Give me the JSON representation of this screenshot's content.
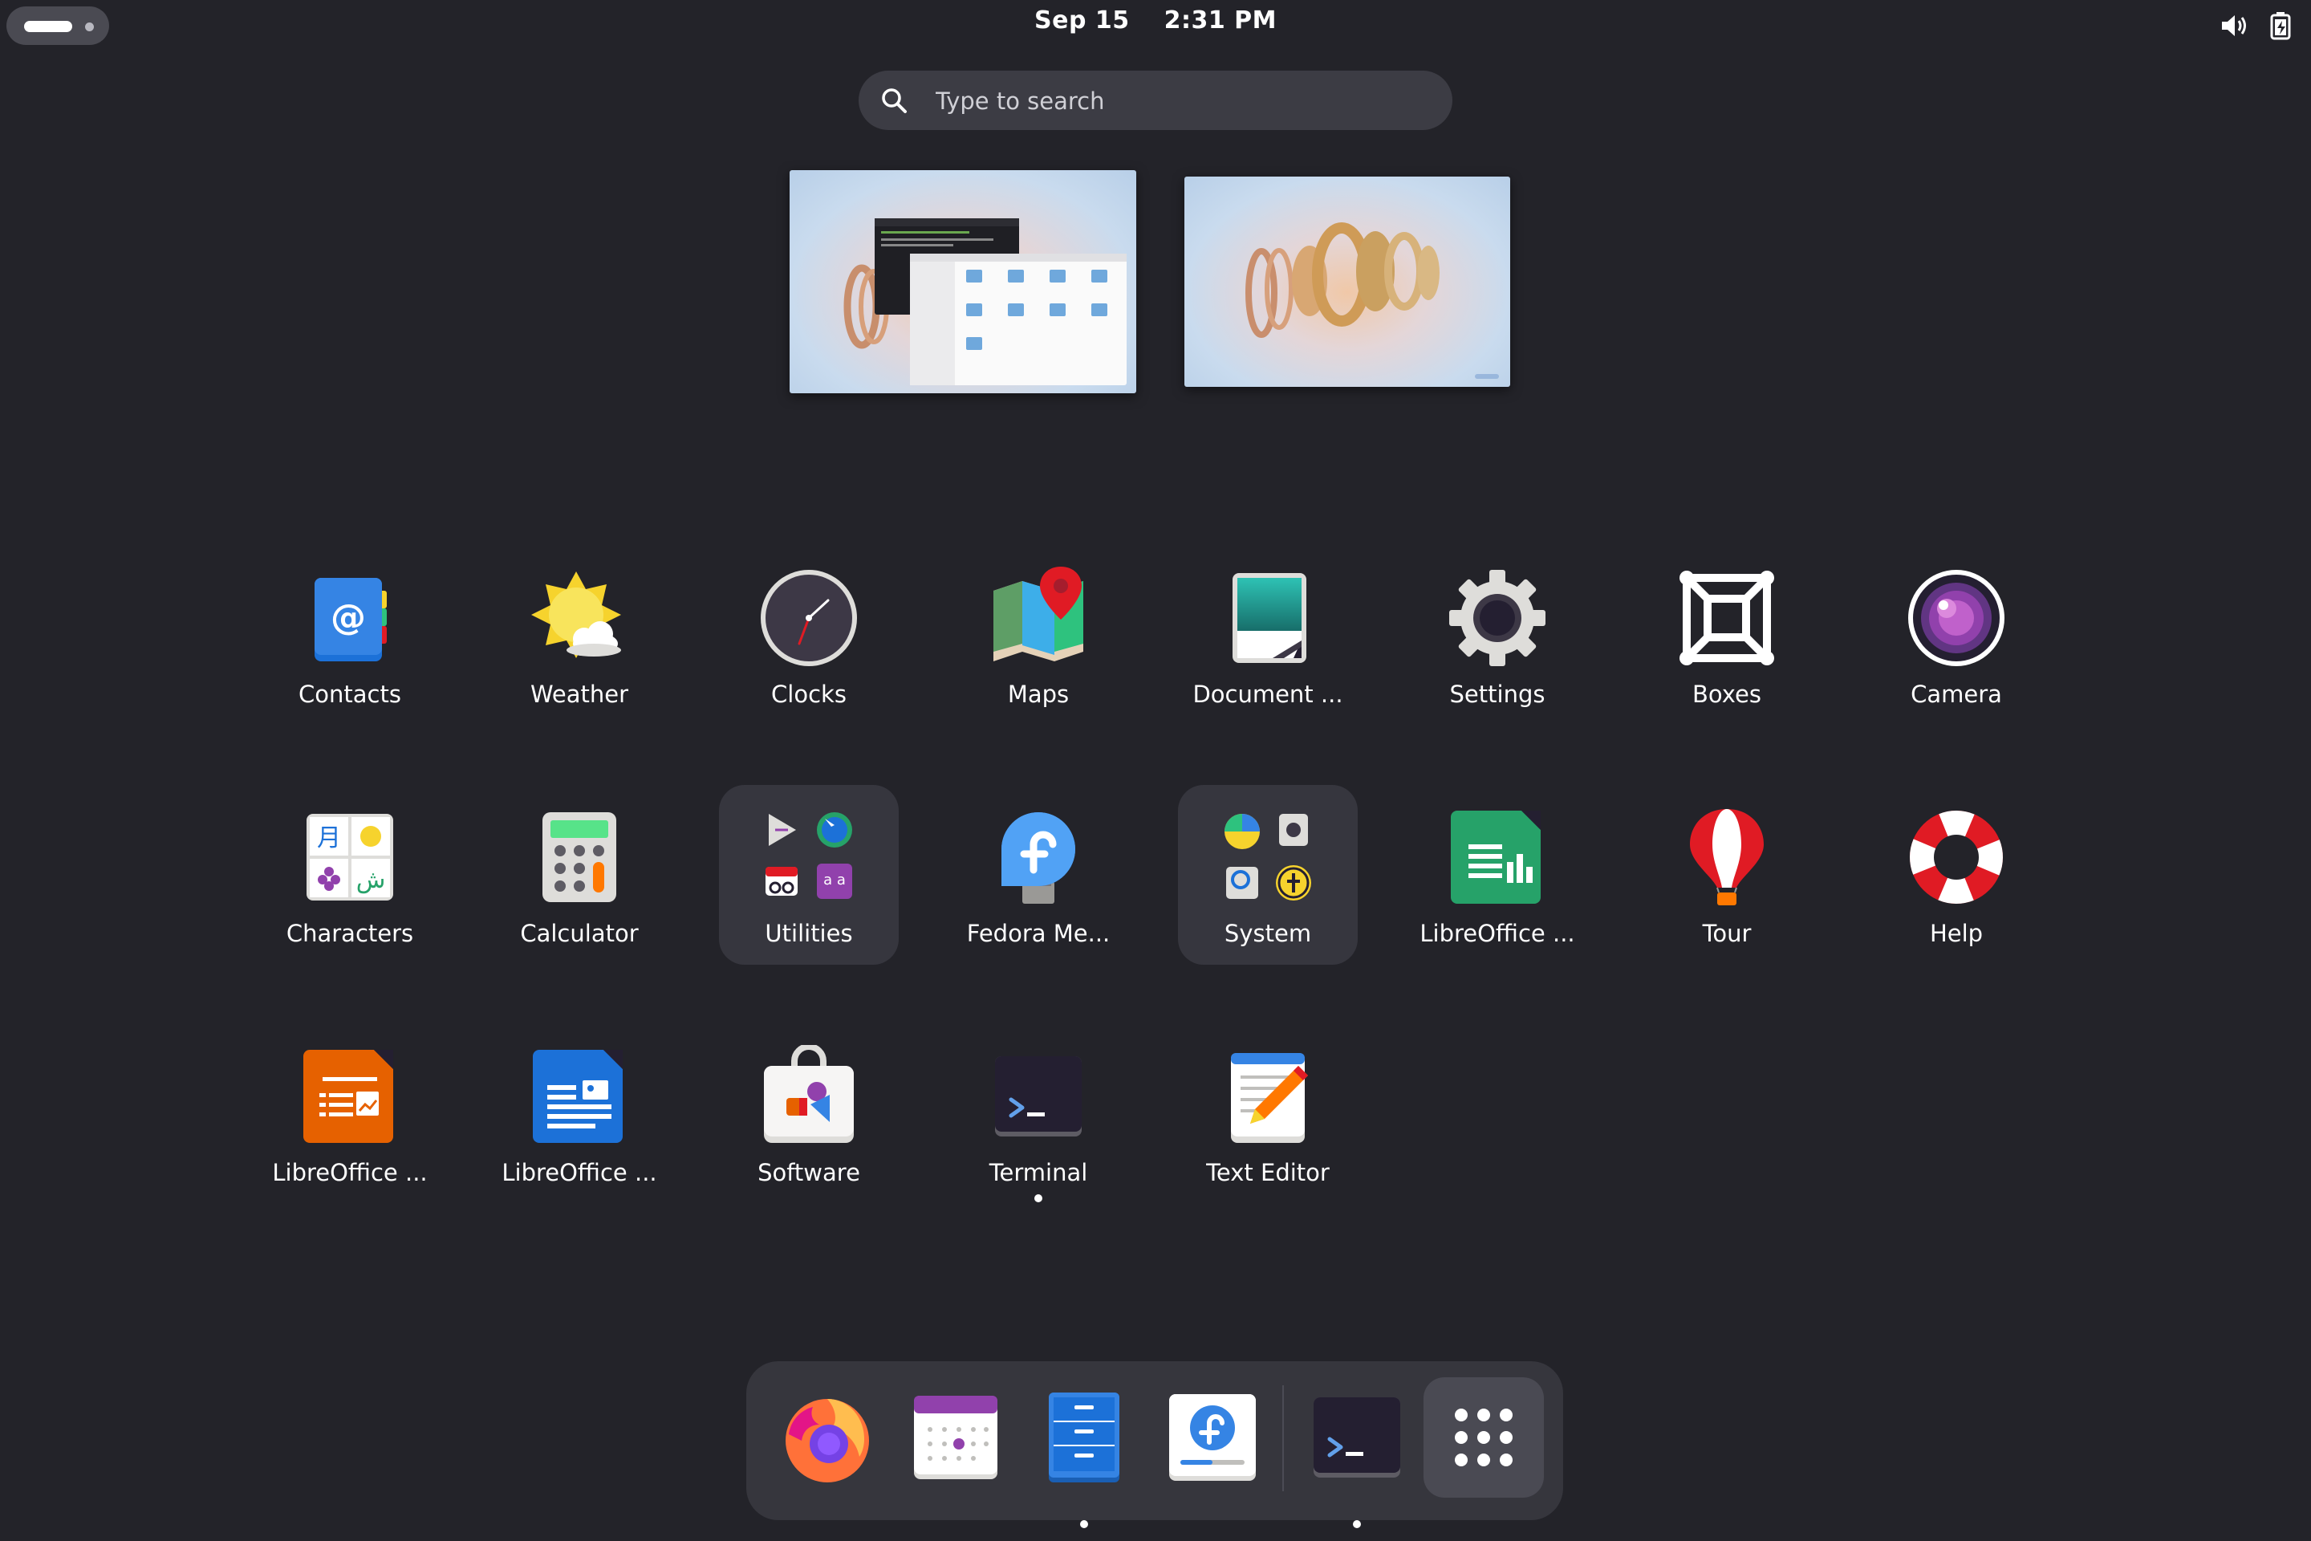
{
  "topbar": {
    "date": "Sep 15",
    "time": "2:31 PM"
  },
  "search": {
    "placeholder": "Type to search"
  },
  "apps": [
    {
      "name": "Contacts",
      "icon": "contacts-icon"
    },
    {
      "name": "Weather",
      "icon": "weather-icon"
    },
    {
      "name": "Clocks",
      "icon": "clocks-icon"
    },
    {
      "name": "Maps",
      "icon": "maps-icon"
    },
    {
      "name": "Document ...",
      "icon": "document-scanner-icon"
    },
    {
      "name": "Settings",
      "icon": "settings-icon"
    },
    {
      "name": "Boxes",
      "icon": "boxes-icon"
    },
    {
      "name": "Camera",
      "icon": "camera-icon"
    },
    {
      "name": "Characters",
      "icon": "characters-icon"
    },
    {
      "name": "Calculator",
      "icon": "calculator-icon"
    },
    {
      "name": "Utilities",
      "icon": "utilities-folder-icon"
    },
    {
      "name": "Fedora Me...",
      "icon": "fedora-media-writer-icon"
    },
    {
      "name": "System",
      "icon": "system-folder-icon"
    },
    {
      "name": "LibreOffice ...",
      "icon": "libreoffice-calc-icon"
    },
    {
      "name": "Tour",
      "icon": "tour-icon"
    },
    {
      "name": "Help",
      "icon": "help-icon"
    },
    {
      "name": "LibreOffice ...",
      "icon": "libreoffice-impress-icon"
    },
    {
      "name": "LibreOffice ...",
      "icon": "libreoffice-writer-icon"
    },
    {
      "name": "Software",
      "icon": "software-icon"
    },
    {
      "name": "Terminal",
      "icon": "terminal-icon",
      "running": true
    },
    {
      "name": "Text Editor",
      "icon": "text-editor-icon"
    }
  ],
  "dash": [
    {
      "icon": "firefox-icon"
    },
    {
      "icon": "calendar-icon"
    },
    {
      "icon": "files-icon",
      "running": true
    },
    {
      "icon": "fedora-media-writer-icon"
    },
    {
      "icon": "terminal-icon",
      "running": true
    },
    {
      "icon": "show-apps-icon"
    }
  ],
  "colors": {
    "background": "#232329",
    "folder": "#36363e",
    "dash": "#36363d",
    "search": "#3c3c44"
  }
}
